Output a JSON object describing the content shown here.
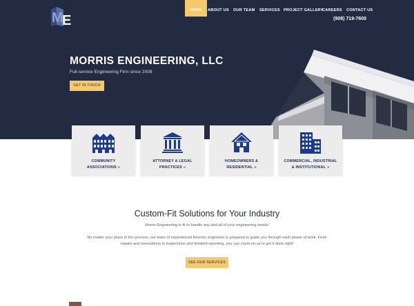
{
  "header": {
    "logo_text": "ME",
    "nav": [
      {
        "label": "HOME",
        "active": true
      },
      {
        "label": "ABOUT US",
        "active": false
      },
      {
        "label": "OUR TEAM",
        "active": false
      },
      {
        "label": "SERVICES",
        "active": false
      },
      {
        "label": "PROJECT GALLERY",
        "active": false
      },
      {
        "label": "CAREERS",
        "active": false
      },
      {
        "label": "CONTACT US",
        "active": false
      }
    ],
    "phone": "(908) 719-7600"
  },
  "hero": {
    "title": "MORRIS ENGINEERING, LLC",
    "subtitle": "Full-service Engineering Firm since 2008",
    "button": "GET IN TOUCH"
  },
  "cards": [
    {
      "line1": "COMMUNITY",
      "line2": "ASSOCIATIONS",
      "icon": "townhouse-icon"
    },
    {
      "line1": "ATTORNEY & LEGAL",
      "line2": "PRACTICES",
      "icon": "courthouse-icon"
    },
    {
      "line1": "HOMEOWNERS &",
      "line2": "RESIDENTIAL",
      "icon": "house-icon"
    },
    {
      "line1": "COMMERCIAL, INDUSTRIAL",
      "line2": "& INSTITUTIONAL",
      "icon": "office-building-icon"
    }
  ],
  "arrow": "»",
  "section": {
    "title": "Custom-Fit Solutions for Your Industry",
    "para1": "Morris Engineering is fit to handle any and all of your engineering needs!",
    "para2": "No matter your place in the process, our team of experienced forensic engineers is prepared to guide you through each phase of work. From repairs and renovations to inspections and detailed reporting, you can count on us to get it done right!",
    "button": "SEE OUR SERVICES"
  },
  "colors": {
    "navy": "#232b42",
    "accent": "#f5c96c",
    "icon_blue": "#1e3a8a"
  }
}
